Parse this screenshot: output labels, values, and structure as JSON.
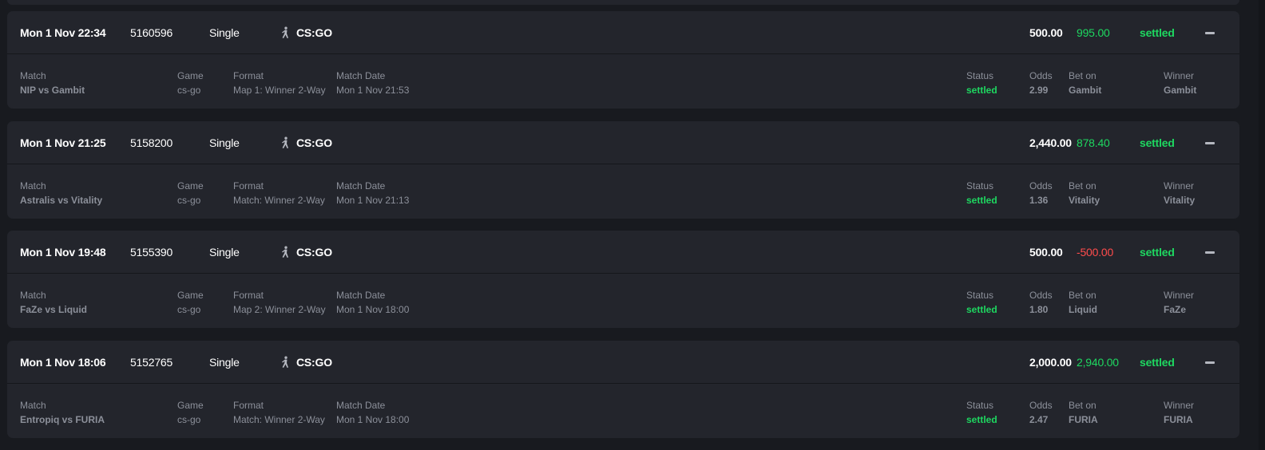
{
  "labels": {
    "match": "Match",
    "game": "Game",
    "format": "Format",
    "match_date": "Match Date",
    "status": "Status",
    "odds": "Odds",
    "bet_on": "Bet on",
    "winner": "Winner"
  },
  "colors": {
    "positive": "#1ed760",
    "negative": "#ff4c4c",
    "card": "#23252c",
    "background": "#181a1f"
  },
  "bets": [
    {
      "date": "Mon 1 Nov 22:34",
      "id": "5160596",
      "type": "Single",
      "sport_icon": "player-icon",
      "sport": "CS:GO",
      "stake": "500.00",
      "payout": "995.00",
      "payout_sign": "positive",
      "status": "settled",
      "match": "NIP vs Gambit",
      "game": "cs-go",
      "format": "Map 1: Winner 2-Way",
      "match_date": "Mon 1 Nov 21:53",
      "detail_status": "settled",
      "odds": "2.99",
      "bet_on": "Gambit",
      "winner": "Gambit"
    },
    {
      "date": "Mon 1 Nov 21:25",
      "id": "5158200",
      "type": "Single",
      "sport_icon": "player-icon",
      "sport": "CS:GO",
      "stake": "2,440.00",
      "payout": "878.40",
      "payout_sign": "positive",
      "status": "settled",
      "match": "Astralis vs Vitality",
      "game": "cs-go",
      "format": "Match: Winner 2-Way",
      "match_date": "Mon 1 Nov 21:13",
      "detail_status": "settled",
      "odds": "1.36",
      "bet_on": "Vitality",
      "winner": "Vitality"
    },
    {
      "date": "Mon 1 Nov 19:48",
      "id": "5155390",
      "type": "Single",
      "sport_icon": "player-icon",
      "sport": "CS:GO",
      "stake": "500.00",
      "payout": "-500.00",
      "payout_sign": "negative",
      "status": "settled",
      "match": "FaZe vs Liquid",
      "game": "cs-go",
      "format": "Map 2: Winner 2-Way",
      "match_date": "Mon 1 Nov 18:00",
      "detail_status": "settled",
      "odds": "1.80",
      "bet_on": "Liquid",
      "winner": "FaZe"
    },
    {
      "date": "Mon 1 Nov 18:06",
      "id": "5152765",
      "type": "Single",
      "sport_icon": "player-icon",
      "sport": "CS:GO",
      "stake": "2,000.00",
      "payout": "2,940.00",
      "payout_sign": "positive",
      "status": "settled",
      "match": "Entropiq vs FURIA",
      "game": "cs-go",
      "format": "Match: Winner 2-Way",
      "match_date": "Mon 1 Nov 18:00",
      "detail_status": "settled",
      "odds": "2.47",
      "bet_on": "FURIA",
      "winner": "FURIA"
    }
  ]
}
